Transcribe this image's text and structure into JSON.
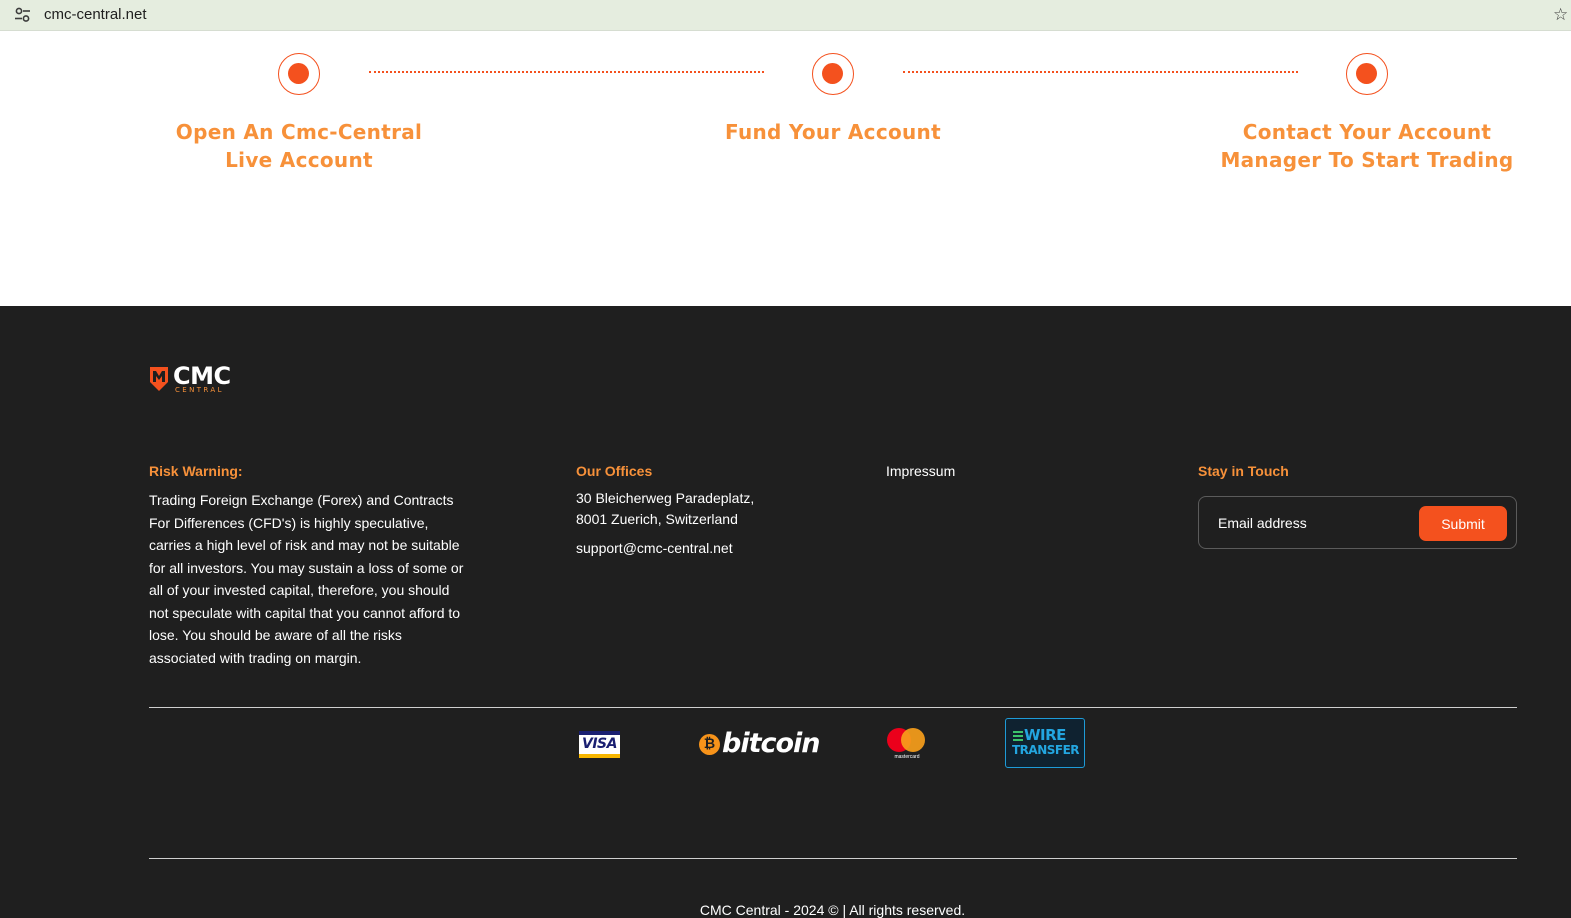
{
  "browser": {
    "url": "cmc-central.net",
    "site_settings_icon": "tune-icon",
    "bookmark_icon": "star-icon"
  },
  "steps": [
    {
      "label_line1": "Open An Cmc-Central",
      "label_line2": "Live Account"
    },
    {
      "label_line1": "Fund Your Account",
      "label_line2": ""
    },
    {
      "label_line1": "Contact Your Account",
      "label_line2": "Manager To Start Trading"
    }
  ],
  "footer": {
    "logo": {
      "main": "CMC",
      "sub": "CENTRAL"
    },
    "risk": {
      "heading": "Risk Warning:",
      "lines": [
        "Trading Foreign Exchange (Forex) and Contracts",
        "For Differences (CFD's) is highly speculative,",
        "carries a high level of risk and may not be suitable",
        "for all investors. You may sustain a loss of some or",
        "all of your invested capital, therefore, you should",
        "not speculate with capital that you cannot afford to",
        "lose. You should be aware of all the risks",
        "associated with trading on margin."
      ]
    },
    "offices": {
      "heading": "Our Offices",
      "address_line1": "30 Bleicherweg Paradeplatz,",
      "address_line2": "8001 Zuerich, Switzerland",
      "email": "support@cmc-central.net"
    },
    "impressum": {
      "link": "Impressum"
    },
    "newsletter": {
      "heading": "Stay in Touch",
      "placeholder": "Email address",
      "submit_label": "Submit"
    },
    "payments": {
      "visa": "VISA",
      "bitcoin_symbol": "₿",
      "bitcoin": "bitcoin",
      "mastercard": "mastercard",
      "wire_line1": "WIRE",
      "wire_line2": "TRANSFER"
    },
    "copyright": "CMC Central - 2024 © | All rights reserved."
  },
  "colors": {
    "accent": "#f4511e",
    "heading_orange": "#f7913a",
    "footer_bg": "#1f1f1f",
    "address_bar_bg": "#e5eddf"
  }
}
